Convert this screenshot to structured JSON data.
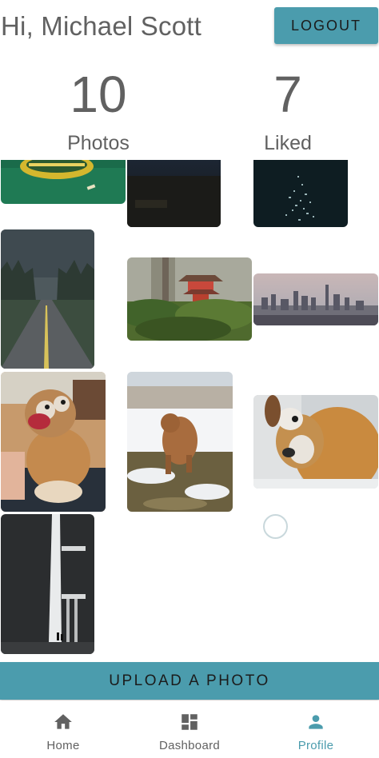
{
  "header": {
    "greeting": "Hi, Michael Scott",
    "logout_label": "LOGOUT"
  },
  "stats": {
    "photos": {
      "count": "10",
      "label": "Photos"
    },
    "liked": {
      "count": "7",
      "label": "Liked"
    }
  },
  "gallery": {
    "photos": [
      {
        "subject": "aerial-green-pier"
      },
      {
        "subject": "dark-night-scene"
      },
      {
        "subject": "dark-night-lights"
      },
      {
        "subject": "forest-road"
      },
      {
        "subject": "red-pagoda-garden"
      },
      {
        "subject": "city-skyline"
      },
      {
        "subject": "dog-on-lap"
      },
      {
        "subject": "dog-in-snow"
      },
      {
        "subject": "dog-closeup"
      },
      {
        "subject": "building-facade"
      }
    ]
  },
  "upload_label": "UPLOAD A PHOTO",
  "nav": {
    "items": [
      {
        "label": "Home",
        "icon": "home-icon"
      },
      {
        "label": "Dashboard",
        "icon": "dashboard-icon"
      },
      {
        "label": "Profile",
        "icon": "person-icon"
      }
    ],
    "active": "Profile"
  },
  "colors": {
    "accent": "#4b9cad",
    "text": "#616161"
  }
}
